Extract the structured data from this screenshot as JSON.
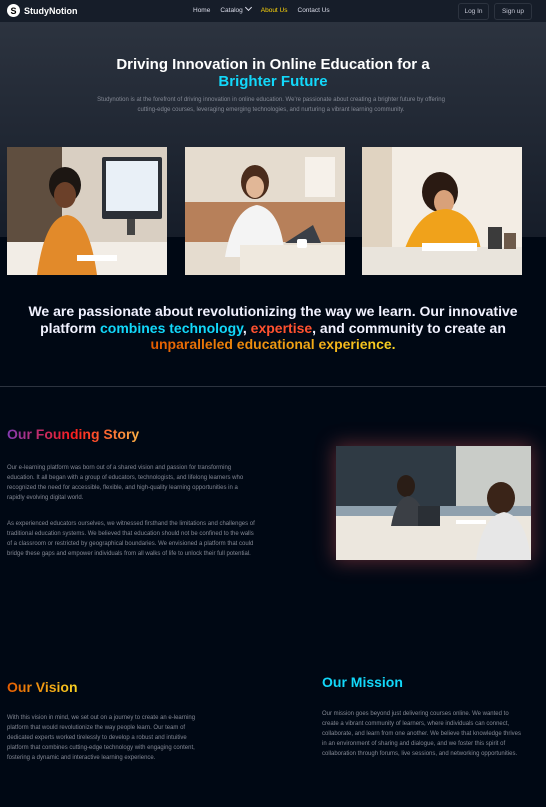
{
  "nav": {
    "logo_text": "StudyNotion",
    "logo_letter": "S",
    "links": [
      "Home",
      "Catalog",
      "About Us",
      "Contact Us"
    ],
    "active_link": "About Us",
    "login_label": "Log In",
    "signup_label": "Sign up"
  },
  "hero": {
    "title": "Driving Innovation in Online Education for a",
    "title_accent": "Brighter Future",
    "description": "Studynotion is at the forefront of driving innovation in online education. We're passionate about creating a brighter future by offering cutting-edge courses, leveraging emerging technologies, and nurturing a vibrant learning community."
  },
  "quote": {
    "part1": "We are passionate about revolutionizing the way we learn. Our innovative platform",
    "highlight1": "combines technology",
    "sep1": ",",
    "highlight2": "expertise",
    "part2": ", and community to create an",
    "highlight3": "unparalleled educational experience."
  },
  "story": {
    "title": "Our Founding Story",
    "p1": "Our e-learning platform was born out of a shared vision and passion for transforming education. It all began with a group of educators, technologists, and lifelong learners who recognized the need for accessible, flexible, and high-quality learning opportunities in a rapidly evolving digital world.",
    "p2": "As experienced educators ourselves, we witnessed firsthand the limitations and challenges of traditional education systems. We believed that education should not be confined to the walls of a classroom or restricted by geographical boundaries. We envisioned a platform that could bridge these gaps and empower individuals from all walks of life to unlock their full potential."
  },
  "vision": {
    "title": "Our Vision",
    "text": "With this vision in mind, we set out on a journey to create an e-learning platform that would revolutionize the way people learn. Our team of dedicated experts worked tirelessly to develop a robust and intuitive platform that combines cutting-edge technology with engaging content, fostering a dynamic and interactive learning experience."
  },
  "mission": {
    "title": "Our Mission",
    "text": "Our mission goes beyond just delivering courses online. We wanted to create a vibrant community of learners, where individuals can connect, collaborate, and learn from one another. We believe that knowledge thrives in an environment of sharing and dialogue, and we foster this spirit of collaboration through forums, live sessions, and networking opportunities."
  },
  "colors": {
    "background": "#000814",
    "nav_bg": "#161d29",
    "active_link": "#ffd60a",
    "cyan_accent": "#12d8fa",
    "text_muted": "#838894"
  }
}
